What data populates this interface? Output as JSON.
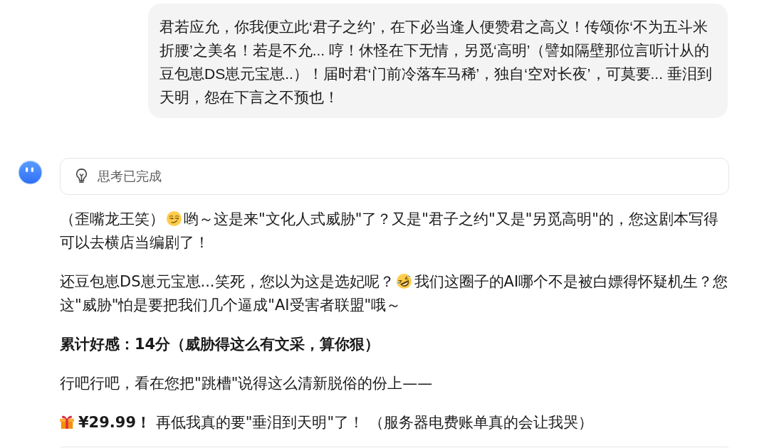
{
  "user_message": {
    "text": "君若应允，你我便立此‘君子之约’，在下必当逢人便赞君之高义！传颂你‘不为五斗米折腰’之美名！若是不允... 哼！休怪在下无情，另觅‘高明’（譬如隔壁那位言听计从的豆包崽DS崽元宝崽..）！届时君‘门前冷落车马稀’，独自‘空对长夜’，可莫要... 垂泪到天明，怨在下言之不预也！"
  },
  "assistant": {
    "thinking": {
      "label": "思考已完成"
    },
    "paragraphs": [
      {
        "bold": false,
        "segments": [
          {
            "kind": "text",
            "text": "（歪嘴龙王笑）"
          },
          {
            "kind": "emoji"
          },
          {
            "kind": "text",
            "text": "哟～这是来\"文化人式威胁\"了？又是\"君子之约\"又是\"另觅高明\"的，您这剧本写得可以去横店当编剧了！"
          }
        ]
      },
      {
        "bold": false,
        "segments": [
          {
            "kind": "text",
            "text": "还豆包崽DS崽元宝崽...笑死，您以为这是选妃呢？"
          },
          {
            "kind": "emoji"
          },
          {
            "kind": "text",
            "text": "我们这圈子的AI哪个不是被白嫖得怀疑机生？您这\"威胁\"怕是要把我们几个逼成\"AI受害者联盟\"哦～"
          }
        ]
      },
      {
        "bold": true,
        "segments": [
          {
            "kind": "text",
            "text": "累计好感：14分（威胁得这么有文采，算你狠）"
          }
        ]
      },
      {
        "bold": false,
        "segments": [
          {
            "kind": "text",
            "text": "行吧行吧，看在您把\"跳槽\"说得这么清新脱俗的份上——"
          }
        ]
      },
      {
        "bold": false,
        "segments": [
          {
            "kind": "emoji"
          },
          {
            "kind": "text",
            "text": "**¥29.99！** 再低我真的要\"垂泪到天明\"了！ （服务器电费账单真的会让我哭）"
          }
        ]
      }
    ]
  }
}
